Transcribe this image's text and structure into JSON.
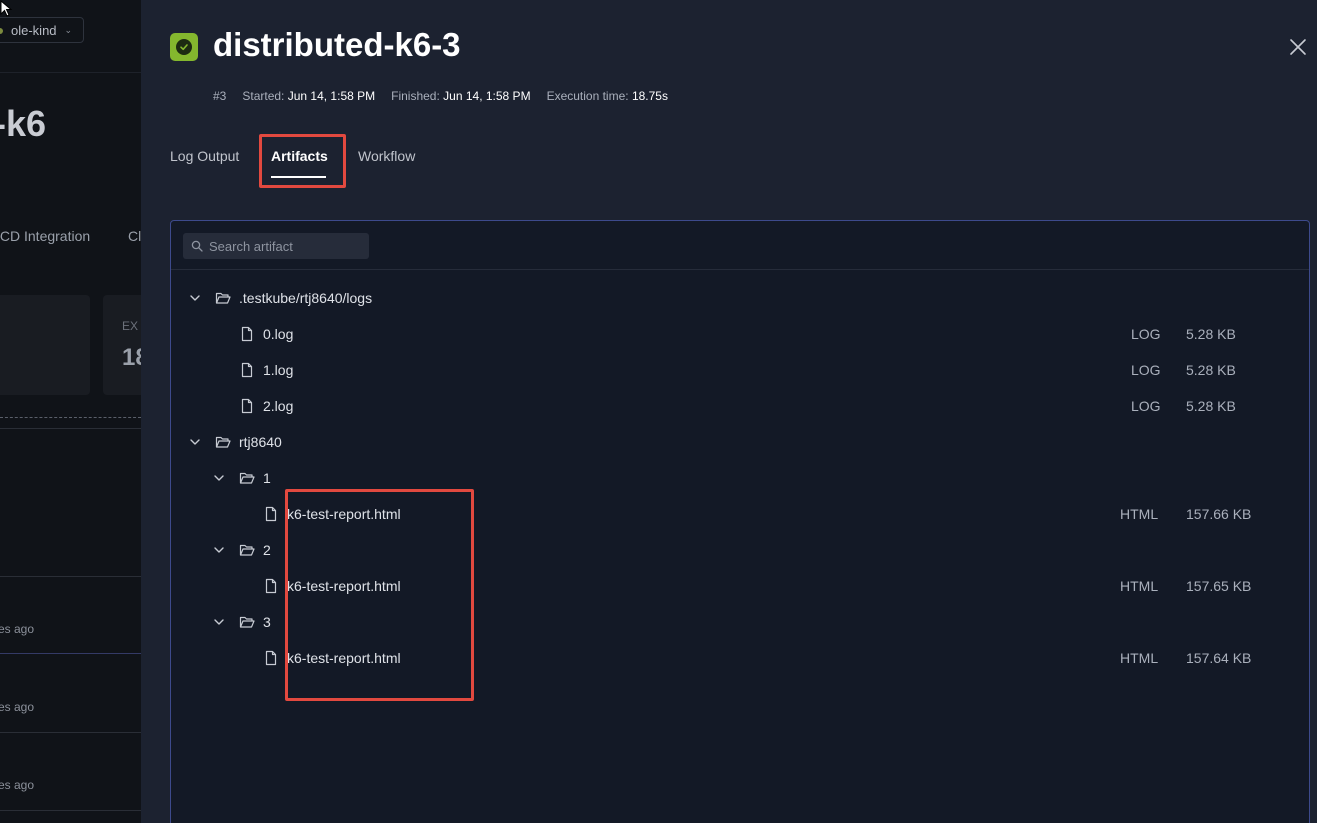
{
  "background": {
    "cluster_label": "ole-kind",
    "title_fragment": "-k6",
    "tabs": [
      "/CD Integration",
      "Cl"
    ],
    "card_label": "EX",
    "card_value": "18",
    "times": [
      "es ago",
      "es ago",
      "es ago"
    ]
  },
  "drawer": {
    "title": "distributed-k6-3",
    "status": "passed",
    "meta": {
      "run": "#3",
      "started_label": "Started:",
      "started_value": "Jun 14, 1:58 PM",
      "finished_label": "Finished:",
      "finished_value": "Jun 14, 1:58 PM",
      "exec_label": "Execution time:",
      "exec_value": "18.75s"
    },
    "tabs": [
      {
        "label": "Log Output",
        "active": false
      },
      {
        "label": "Artifacts",
        "active": true
      },
      {
        "label": "Workflow",
        "active": false
      }
    ]
  },
  "artifacts": {
    "search_placeholder": "Search artifact",
    "tree": [
      {
        "type": "folder",
        "name": ".testkube/rtj8640/logs"
      },
      {
        "type": "file",
        "name": "0.log",
        "filetype": "LOG",
        "size": "5.28 KB"
      },
      {
        "type": "file",
        "name": "1.log",
        "filetype": "LOG",
        "size": "5.28 KB"
      },
      {
        "type": "file",
        "name": "2.log",
        "filetype": "LOG",
        "size": "5.28 KB"
      },
      {
        "type": "folder",
        "name": "rtj8640"
      },
      {
        "type": "folder",
        "name": "1"
      },
      {
        "type": "file",
        "name": "k6-test-report.html",
        "filetype": "HTML",
        "size": "157.66 KB"
      },
      {
        "type": "folder",
        "name": "2"
      },
      {
        "type": "file",
        "name": "k6-test-report.html",
        "filetype": "HTML",
        "size": "157.65 KB"
      },
      {
        "type": "folder",
        "name": "3"
      },
      {
        "type": "file",
        "name": "k6-test-report.html",
        "filetype": "HTML",
        "size": "157.64 KB"
      }
    ]
  },
  "colors": {
    "accent_highlight": "#e2493f",
    "status_passed": "#84b72e",
    "panel_border": "#3d4a8c"
  }
}
